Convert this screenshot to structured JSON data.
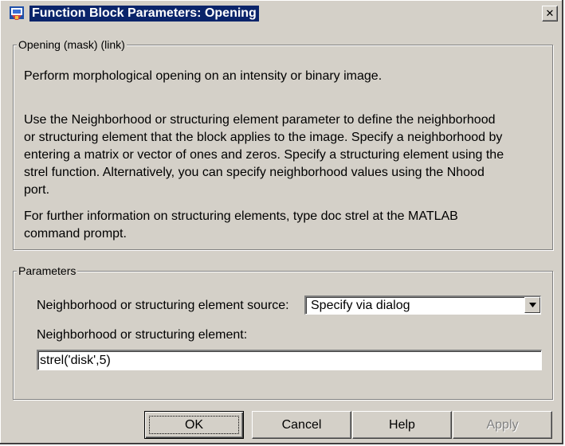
{
  "window": {
    "title": "Function Block Parameters: Opening",
    "close_glyph": "✕"
  },
  "description_group": {
    "legend": "Opening (mask) (link)",
    "lines": [
      "Perform morphological opening on an intensity or binary image.",
      "Use the Neighborhood or structuring element parameter to define the neighborhood",
      "or structuring element that the block applies to the image.  Specify a neighborhood by",
      "entering a matrix or vector of ones and zeros.  Specify a structuring element using the",
      "strel function.  Alternatively, you can specify neighborhood values using the Nhood",
      "port.",
      "For further information on structuring elements, type doc strel at the MATLAB",
      "command prompt."
    ]
  },
  "parameters_group": {
    "legend": "Parameters",
    "source_label": "Neighborhood or structuring element source:",
    "source_value": "Specify via dialog",
    "element_label": "Neighborhood or structuring element:",
    "element_value": "strel('disk',5)"
  },
  "buttons": {
    "ok": "OK",
    "cancel": "Cancel",
    "help": "Help",
    "apply": "Apply"
  }
}
